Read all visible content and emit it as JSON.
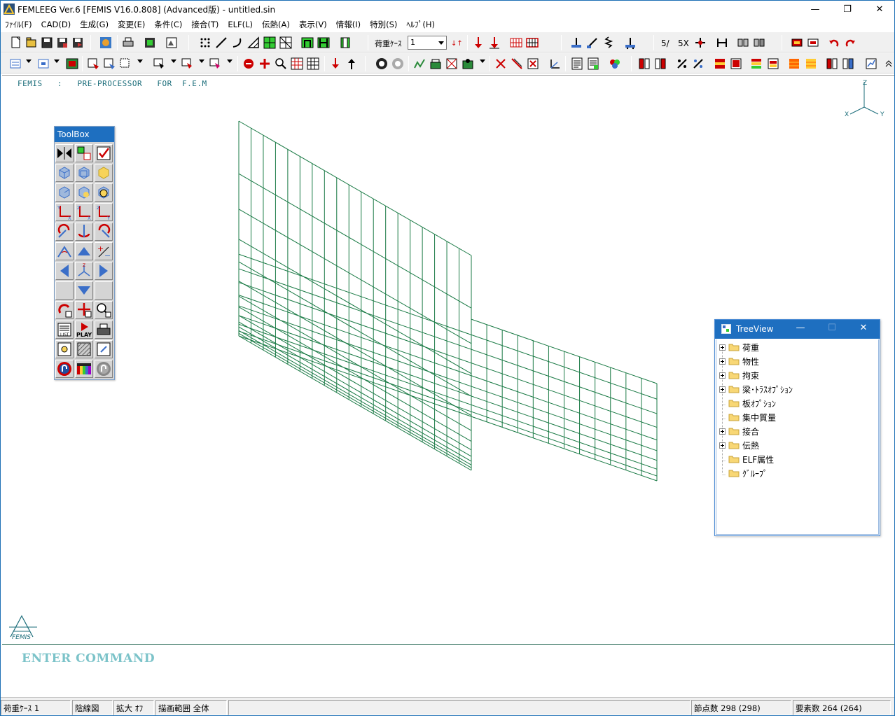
{
  "window": {
    "title": "FEMLEEG Ver.6 [FEMIS V16.0.808] (Advanced版) - untitled.sin",
    "minimize_glyph": "—",
    "maximize_glyph": "❐",
    "close_glyph": "✕"
  },
  "menu": [
    {
      "label": "ﾌｧｲﾙ(F)"
    },
    {
      "label": "CAD(D)"
    },
    {
      "label": "生成(G)"
    },
    {
      "label": "変更(E)"
    },
    {
      "label": "条件(C)"
    },
    {
      "label": "接合(T)"
    },
    {
      "label": "ELF(L)"
    },
    {
      "label": "伝熱(A)"
    },
    {
      "label": "表示(V)"
    },
    {
      "label": "情報(I)"
    },
    {
      "label": "特別(S)"
    },
    {
      "label": "ﾍﾙﾌﾟ(H)"
    }
  ],
  "toolbar": {
    "loadcase_label": "荷重ｹｰｽ",
    "loadcase_value": "1"
  },
  "canvas": {
    "banner": "FEMIS   :   PRE-PROCESSOR   FOR  F.E.M",
    "axis_z": "Z",
    "axis_x": "X",
    "axis_y": "Y",
    "mesh_color": "#1a7a45"
  },
  "toolbox": {
    "title": "ToolBox"
  },
  "treeview": {
    "title": "TreeView",
    "items": [
      {
        "label": "荷重",
        "expandable": true
      },
      {
        "label": "物性",
        "expandable": true
      },
      {
        "label": "拘束",
        "expandable": true
      },
      {
        "label": "梁･ﾄﾗｽｵﾌﾟｼｮﾝ",
        "expandable": true
      },
      {
        "label": "板ｵﾌﾟｼｮﾝ",
        "expandable": false
      },
      {
        "label": "集中質量",
        "expandable": false
      },
      {
        "label": "接合",
        "expandable": true
      },
      {
        "label": "伝熱",
        "expandable": true
      },
      {
        "label": "ELF属性",
        "expandable": false
      },
      {
        "label": "ｸﾞﾙｰﾌﾟ",
        "expandable": false
      }
    ]
  },
  "command": {
    "prompt": "ENTER  COMMAND"
  },
  "status": {
    "loadcase": "荷重ｹｰｽ 1",
    "hidden_line": "陰線図",
    "zoom": "拡大 ｵﾌ",
    "draw_range": "描画範囲 全体",
    "nodes": "節点数 298 (298)",
    "elements": "要素数 264 (264)"
  }
}
